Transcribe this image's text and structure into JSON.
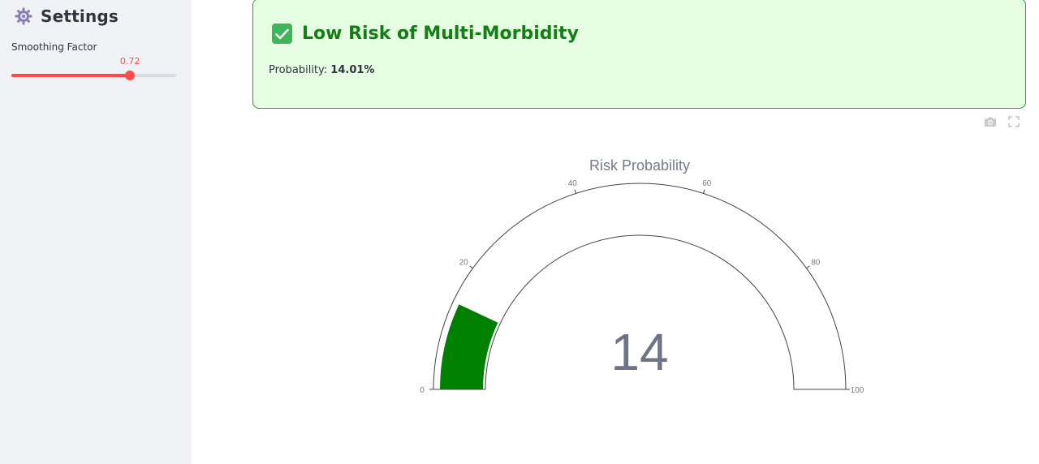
{
  "sidebar": {
    "title": "Settings",
    "icon": "gear-icon",
    "slider": {
      "label": "Smoothing Factor",
      "value_text": "0.72",
      "value": 0.72,
      "min": 0,
      "max": 1,
      "accent": "#ff4b4b"
    }
  },
  "alert": {
    "icon": "check-mark-icon",
    "title": "Low Risk of Multi-Morbidity",
    "probability_label": "Probability:",
    "probability_value": "14.01%",
    "bg_color": "#e6fde3",
    "text_color": "#157d15"
  },
  "toolbar": {
    "camera_icon": "camera-icon",
    "fullscreen_icon": "fullscreen-icon"
  },
  "chart_data": {
    "type": "gauge",
    "title": "Risk Probability",
    "value": 14.01,
    "value_text": "14",
    "range": [
      0,
      100
    ],
    "ticks": [
      0,
      20,
      40,
      60,
      80,
      100
    ],
    "bar_color": "#008000"
  }
}
